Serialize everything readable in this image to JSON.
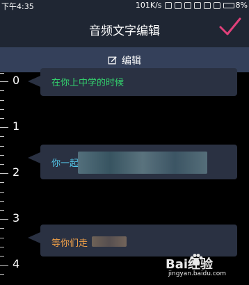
{
  "status_bar": {
    "time": "下午4:35",
    "network_speed": "101K/s",
    "battery": "8%"
  },
  "header": {
    "title": "音频文字编辑"
  },
  "toolbar": {
    "edit_label": "编辑"
  },
  "timeline": {
    "ticks": [
      "0",
      "1",
      "2",
      "3",
      "4"
    ]
  },
  "captions": [
    {
      "text": "在你上中学的时候",
      "color": "#33d16d"
    },
    {
      "text": "你一起",
      "color": "#54c6e8"
    },
    {
      "text": "等你们走",
      "color": "#f0a048"
    }
  ],
  "watermark": {
    "logo": "Bai经验",
    "url": "jingyan.baidu.com"
  },
  "colors": {
    "accent_check": "#e0407a",
    "bg_dark": "#1f2633",
    "edit_bar": "#34405a",
    "bubble": "#2a3142"
  }
}
